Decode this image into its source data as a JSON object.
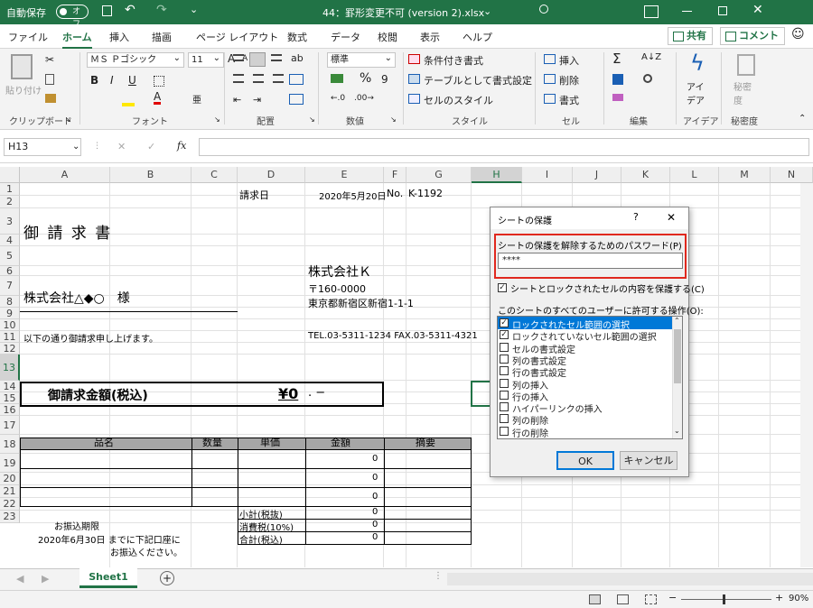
{
  "titlebar": {
    "autosave_label": "自動保存",
    "autosave_state": "オフ",
    "filename": "44：罫形変更不可 (version 2).xlsx",
    "filename_caret": "⌄"
  },
  "tabs": [
    "ファイル",
    "ホーム",
    "挿入",
    "描画",
    "ページ レイアウト",
    "数式",
    "データ",
    "校閲",
    "表示",
    "ヘルプ"
  ],
  "header_buttons": {
    "share": "共有",
    "comment": "コメント"
  },
  "ribbon": {
    "paste": "貼り付け",
    "font_name": "ＭＳ Ｐゴシック",
    "font_size": "11",
    "bold": "B",
    "italic": "I",
    "underline": "U",
    "grow": "A",
    "shrink": "A",
    "number_format": "標準",
    "percent": "%",
    "comma": "9",
    "styles": [
      "条件付き書式",
      "テーブルとして書式設定",
      "セルのスタイル"
    ],
    "cells": [
      "挿入",
      "削除",
      "書式"
    ],
    "ideas": "アイデア",
    "sensitivity": "秘密度",
    "groups": [
      "クリップボード",
      "フォント",
      "配置",
      "数値",
      "スタイル",
      "セル",
      "編集",
      "アイデア",
      "秘密度"
    ]
  },
  "formula_bar": {
    "name_box": "H13",
    "cancel": "✕",
    "enter": "✓",
    "fx": "fx",
    "content": ""
  },
  "columns": [
    "A",
    "B",
    "C",
    "D",
    "E",
    "F",
    "G",
    "H",
    "I",
    "J",
    "K",
    "L",
    "M",
    "N"
  ],
  "rows": [
    "1",
    "2",
    "3",
    "4",
    "5",
    "6",
    "7",
    "8",
    "9",
    "10",
    "11",
    "12",
    "13",
    "14",
    "15",
    "16",
    "17",
    "18",
    "19",
    "20",
    "21",
    "22",
    "23"
  ],
  "invoice": {
    "date_label": "請求日",
    "date": "2020年5月20日",
    "no_label": "No.",
    "no": "K-1192",
    "title": "御 請 求 書",
    "company": "株式会社Ｋ",
    "postal": "〒160-0000",
    "address": "東京都新宿区新宿1-1-1",
    "customer": "株式会社△◆○　様",
    "intro": "以下の通り御請求申し上げます。",
    "tel": "TEL.03-5311-1234 FAX.03-5311-4321",
    "total_label": "御請求金額(税込)",
    "total_value": "¥0",
    "total_suffix": ". −",
    "table_headers": [
      "品名",
      "数量",
      "単価",
      "金額",
      "摘要"
    ],
    "amounts": [
      "0",
      "0",
      "0"
    ],
    "subtotal_label": "小計(税抜)",
    "tax_label": "消費税(10%)",
    "grand_label": "合計(税込)",
    "subtotal": "0",
    "tax": "0",
    "grand": "0",
    "payment_label": "お振込期限",
    "payment_line": "2020年6月30日 までに下記口座に",
    "payment_end": "お振込ください。"
  },
  "sheet_tab": "Sheet1",
  "status": {
    "zoom": "90%"
  },
  "dialog": {
    "title": "シートの保護",
    "help": "?",
    "close": "✕",
    "password_label": "シートの保護を解除するためのパスワード(P)",
    "password_value": "****",
    "protect_label": "シートとロックされたセルの内容を保護する(C)",
    "allow_label": "このシートのすべてのユーザーに許可する操作(O):",
    "options": [
      {
        "label": "ロックされたセル範囲の選択",
        "checked": "✓"
      },
      {
        "label": "ロックされていないセル範囲の選択",
        "checked": "✓"
      },
      {
        "label": "セルの書式設定",
        "checked": ""
      },
      {
        "label": "列の書式設定",
        "checked": ""
      },
      {
        "label": "行の書式設定",
        "checked": ""
      },
      {
        "label": "列の挿入",
        "checked": ""
      },
      {
        "label": "行の挿入",
        "checked": ""
      },
      {
        "label": "ハイパーリンクの挿入",
        "checked": ""
      },
      {
        "label": "列の削除",
        "checked": ""
      },
      {
        "label": "行の削除",
        "checked": ""
      }
    ],
    "ok": "OK",
    "cancel": "キャンセル"
  },
  "colors": {
    "excel_green": "#217346",
    "highlight_red": "#e0281e",
    "selection_blue": "#0078d7"
  }
}
